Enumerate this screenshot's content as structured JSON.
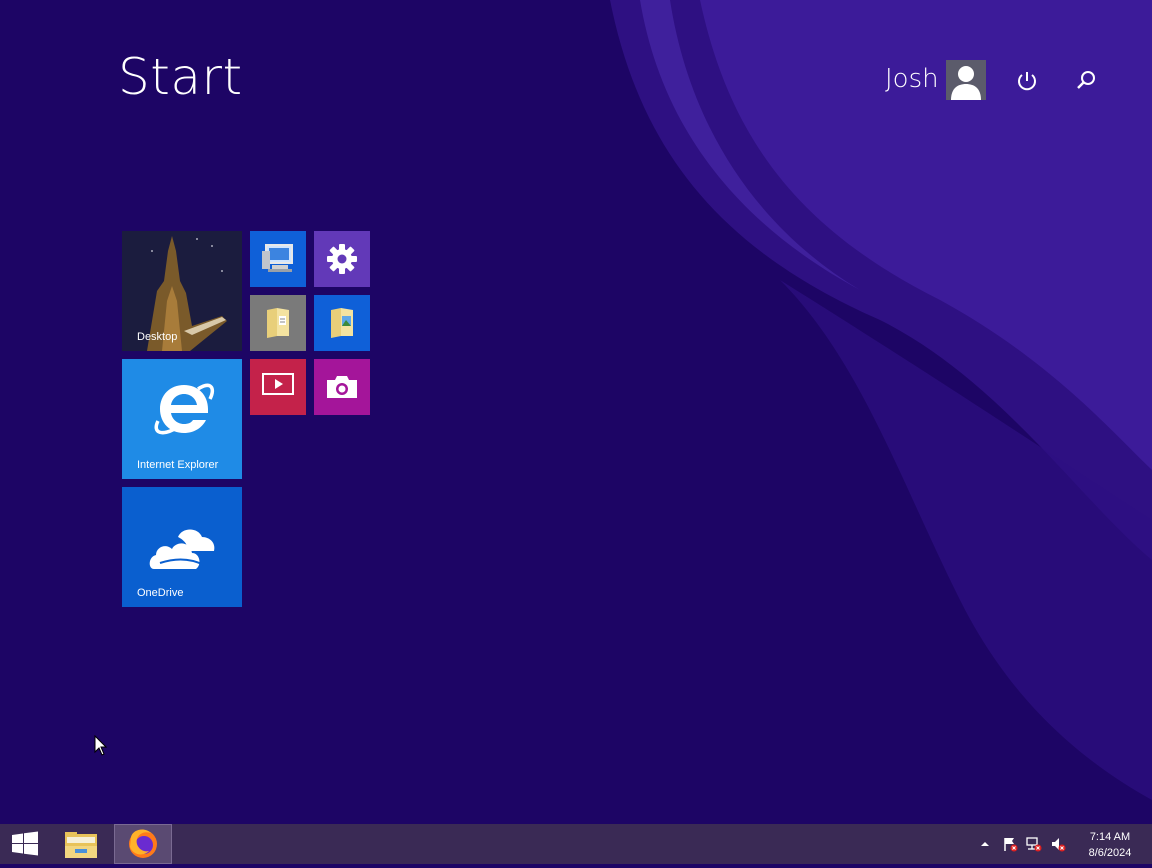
{
  "start": {
    "title": "Start"
  },
  "user": {
    "name": "Josh"
  },
  "icons": {
    "power": "power-icon",
    "search": "search-icon",
    "avatar": "user-avatar-icon"
  },
  "tiles": {
    "desktop": {
      "label": "Desktop"
    },
    "internet_explorer": {
      "label": "Internet Explorer"
    },
    "onedrive": {
      "label": "OneDrive"
    },
    "this_pc": {
      "label": ""
    },
    "settings": {
      "label": ""
    },
    "documents": {
      "label": ""
    },
    "pictures": {
      "label": ""
    },
    "video": {
      "label": ""
    },
    "camera": {
      "label": ""
    }
  },
  "taskbar": {
    "clock_time": "7:14 AM",
    "clock_date": "8/6/2024"
  },
  "colors": {
    "background": "#1d0565",
    "taskbar": "#3a2a55",
    "tile_blue": "#0f60d8",
    "tile_ie": "#1f8be6",
    "tile_purple": "#6239b8",
    "tile_red": "#c4224a",
    "tile_magenta": "#a4159a",
    "tile_gray": "#7a7a7a"
  }
}
